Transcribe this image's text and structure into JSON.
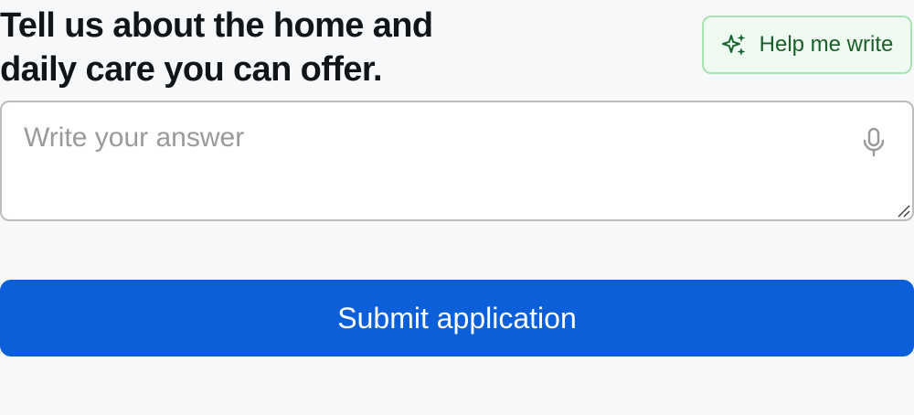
{
  "question": {
    "title": "Tell us about the home and daily care you can offer."
  },
  "help_button": {
    "label": "Help me write",
    "icon": "sparkle-icon"
  },
  "answer": {
    "placeholder": "Write your answer",
    "value": "",
    "mic_icon": "microphone-icon"
  },
  "submit_button": {
    "label": "Submit application"
  },
  "colors": {
    "background": "#f7f8fa",
    "heading": "#111418",
    "help_border": "#a9e3b4",
    "help_bg": "#effbf1",
    "help_text": "#1b5e2c",
    "input_border": "#bdbdbd",
    "placeholder": "#9a9a9a",
    "submit_bg": "#0b5fd9",
    "submit_text": "#ffffff"
  }
}
